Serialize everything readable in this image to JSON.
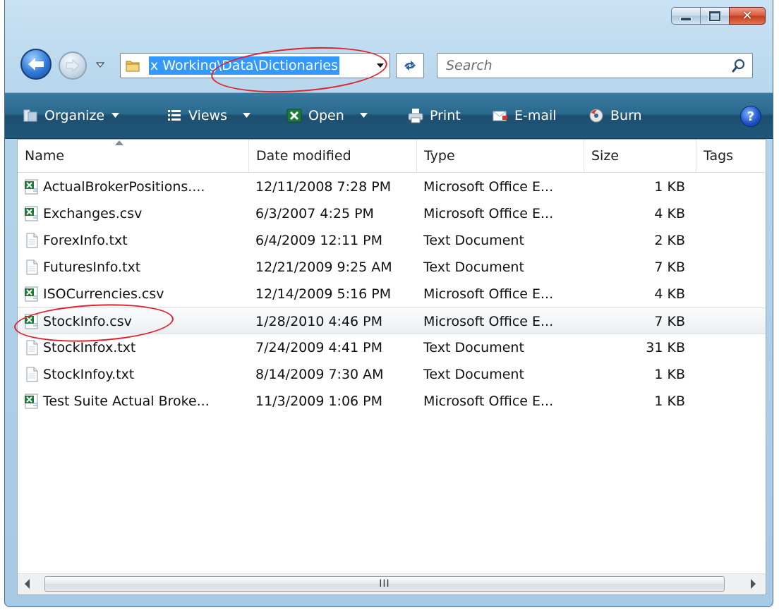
{
  "address": {
    "path": "x Working\\Data\\Dictionaries"
  },
  "search": {
    "placeholder": "Search"
  },
  "toolbar": {
    "organize": "Organize",
    "views": "Views",
    "open": "Open",
    "print": "Print",
    "email": "E-mail",
    "burn": "Burn",
    "help": "?"
  },
  "columns": {
    "name": "Name",
    "date": "Date modified",
    "type": "Type",
    "size": "Size",
    "tags": "Tags"
  },
  "files": [
    {
      "name": "ActualBrokerPositions....",
      "date": "12/11/2008 7:28 PM",
      "type": "Microsoft Office E...",
      "size": "1 KB",
      "icon": "excel-csv-icon"
    },
    {
      "name": "Exchanges.csv",
      "date": "6/3/2007 4:25 PM",
      "type": "Microsoft Office E...",
      "size": "4 KB",
      "icon": "excel-csv-icon"
    },
    {
      "name": "ForexInfo.txt",
      "date": "6/4/2009 12:11 PM",
      "type": "Text Document",
      "size": "2 KB",
      "icon": "text-document-icon"
    },
    {
      "name": "FuturesInfo.txt",
      "date": "12/21/2009 9:25 AM",
      "type": "Text Document",
      "size": "7 KB",
      "icon": "text-document-icon"
    },
    {
      "name": "ISOCurrencies.csv",
      "date": "12/14/2009 5:16 PM",
      "type": "Microsoft Office E...",
      "size": "4 KB",
      "icon": "excel-csv-icon"
    },
    {
      "name": "StockInfo.csv",
      "date": "1/28/2010 4:46 PM",
      "type": "Microsoft Office E...",
      "size": "7 KB",
      "icon": "excel-csv-icon"
    },
    {
      "name": "StockInfox.txt",
      "date": "7/24/2009 4:41 PM",
      "type": "Text Document",
      "size": "31 KB",
      "icon": "text-document-icon"
    },
    {
      "name": "StockInfoy.txt",
      "date": "8/14/2009 7:30 AM",
      "type": "Text Document",
      "size": "1 KB",
      "icon": "text-document-icon"
    },
    {
      "name": "Test Suite Actual Broke...",
      "date": "11/3/2009 1:06 PM",
      "type": "Microsoft Office E...",
      "size": "1 KB",
      "icon": "excel-csv-icon"
    }
  ],
  "scrollbar": {
    "thumb_grip": "III"
  },
  "colors": {
    "toolbar": "#2b6a8f",
    "selection": "#3399ff",
    "annotation": "#e0202a"
  }
}
